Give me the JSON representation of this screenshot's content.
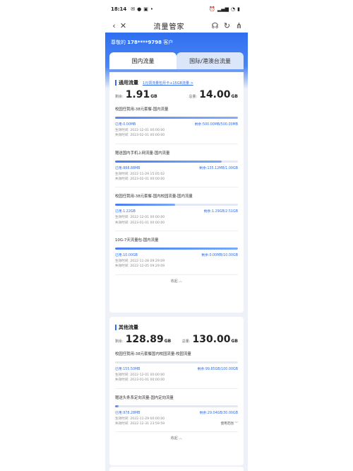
{
  "status_bar": {
    "time": "18:14",
    "left_icons": [
      "message-icon",
      "chat-icon",
      "app-icon",
      "wifi-icon"
    ],
    "battery": "▮"
  },
  "app_bar": {
    "title": "流量管家"
  },
  "greeting": {
    "prefix": "尊敬的",
    "phone": "178****9798",
    "suffix": "客户"
  },
  "tabs": [
    {
      "label": "国内流量",
      "active": true
    },
    {
      "label": "国际/港澳台流量",
      "active": false
    }
  ],
  "general": {
    "label": "通用流量",
    "link": "1元领流量包月卡+15GB流量 >",
    "remaining_label": "剩余:",
    "remaining_value": "1.91",
    "remaining_unit": "GB",
    "total_label": "总量:",
    "total_value": "14.00",
    "total_unit": "GB",
    "collapse": "收起 ︿",
    "packages": [
      {
        "name": "校园任我用-38元套餐-国内流量",
        "used": "已用:0.00MB",
        "remain": "剩余:500.00MB/500.00MB",
        "used_fraction": 0.0,
        "start": "生效时间:  2022-12-01 00:00:00",
        "end": "失效时间:  2023-02-01 00:00:00"
      },
      {
        "name": "赠送国内手机上网流量-国内流量",
        "used": "已用:888.88MB",
        "remain": "剩余:135.12MB/1.00GB",
        "used_fraction": 0.87,
        "start": "生效时间:  2022-11-29 15:05:02",
        "end": "失效时间:  2023-02-01 00:00:00"
      },
      {
        "name": "校园任我用-38元套餐-国内校园流量-国内流量",
        "used": "已用:1.22GB",
        "remain": "剩余:1.29GB/2.51GB",
        "used_fraction": 0.49,
        "start": "生效时间:  2022-12-01 00:00:00",
        "end": "失效时间:  2023-01-01 00:00:00"
      },
      {
        "name": "10G-7天流量包-国内流量",
        "used": "已用:10.00GB",
        "remain": "剩余:0.00MB/10.00GB",
        "used_fraction": 1.0,
        "start": "生效时间:  2022-11-28 09:29:09",
        "end": "失效时间:  2022-12-05 09:29:09"
      }
    ]
  },
  "other": {
    "label": "其他流量",
    "remaining_label": "剩余:",
    "remaining_value": "128.89",
    "remaining_unit": "GB",
    "total_label": "总量:",
    "total_value": "130.00",
    "total_unit": "GB",
    "collapse": "收起 ︿",
    "packages": [
      {
        "name": "校园任我用-38元套餐国内校园流量-校园流量",
        "used": "已用:155.50MB",
        "remain": "剩余:99.85GB/100.00GB",
        "used_fraction": 0.002,
        "start": "生效时间:  2022-12-01 00:00:00",
        "end": "失效时间:  2023-01-01 00:00:00",
        "scope": ""
      },
      {
        "name": "赠送头条系定向流量-国内定向流量",
        "used": "已用:978.28MB",
        "remain": "剩余:29.04GB/30.00GB",
        "used_fraction": 0.03,
        "start": "生效时间:  2022-11-29 00:00:00",
        "end": "失效时间:  2022-12-31 23:59:59",
        "scope": "使用范围 ﹀"
      }
    ]
  }
}
